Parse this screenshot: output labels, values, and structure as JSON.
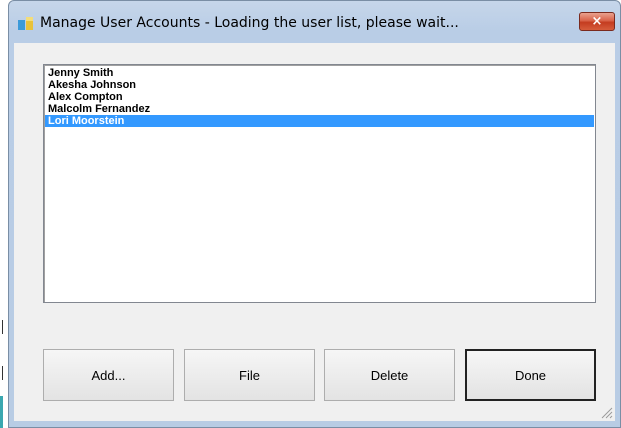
{
  "window": {
    "title": "Manage User Accounts - Loading the user list, please wait...",
    "close_glyph": "×"
  },
  "users": [
    {
      "name": "Jenny Smith",
      "selected": false
    },
    {
      "name": "Akesha Johnson",
      "selected": false
    },
    {
      "name": "Alex Compton",
      "selected": false
    },
    {
      "name": "Malcolm Fernandez",
      "selected": false
    },
    {
      "name": "Lori Moorstein",
      "selected": true
    }
  ],
  "buttons": {
    "add": "Add...",
    "file": "File",
    "delete": "Delete",
    "done": "Done"
  },
  "colors": {
    "selection": "#3399ff",
    "frame": "#b9cde6",
    "close": "#c43c20"
  },
  "icons": {
    "app": "app-icon",
    "close": "close-icon",
    "resize": "resize-grip-icon"
  }
}
